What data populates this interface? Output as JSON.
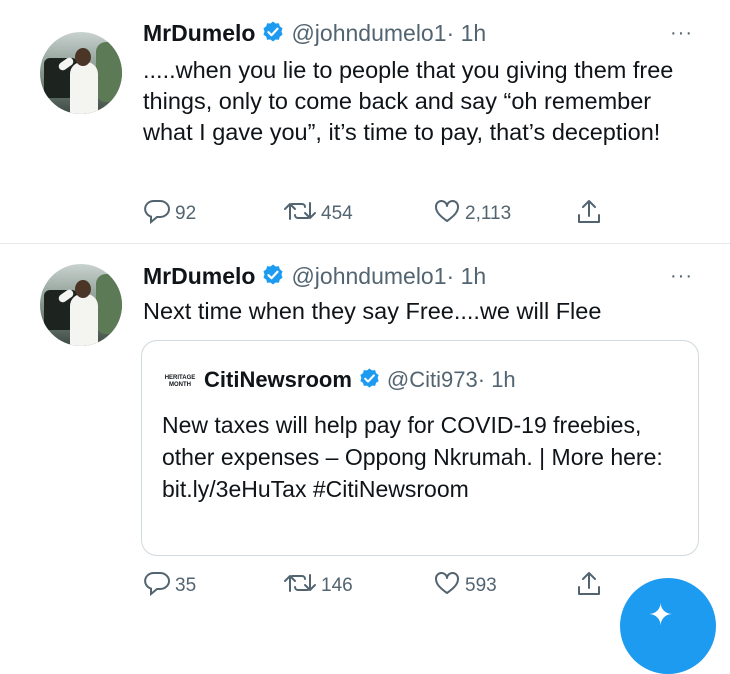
{
  "tweets": [
    {
      "name": "MrDumelo",
      "handle": "@johndumelo1",
      "time": "· 1h",
      "more": "···",
      "text": ".....when you lie to people that you giving them free things, only to come back and say “oh remember what I gave you”, it’s time to pay, that’s deception!",
      "replies": "92",
      "retweets": "454",
      "likes": "2,113"
    },
    {
      "name": "MrDumelo",
      "handle": "@johndumelo1",
      "time": "· 1h",
      "more": "···",
      "text": "Next time when they say Free....we will Flee",
      "replies": "35",
      "retweets": "146",
      "likes": "593",
      "quote": {
        "logo_text": "HERITAGE MONTH",
        "name": "CitiNewsroom",
        "handle": "@Citi973",
        "time": "· 1h",
        "text": "New taxes will help pay for COVID-19 freebies, other expenses – Oppong Nkrumah. | More here: bit.ly/3eHuTax #CitiNewsroom"
      }
    }
  ],
  "icons": {
    "verified": "verified-badge-icon",
    "reply": "reply-icon",
    "retweet": "retweet-icon",
    "like": "heart-icon",
    "share": "share-icon",
    "compose": "compose-tweet-icon"
  },
  "colors": {
    "accent": "#1d9bf0",
    "secondary_text": "#536471",
    "primary_text": "#0f1419"
  }
}
